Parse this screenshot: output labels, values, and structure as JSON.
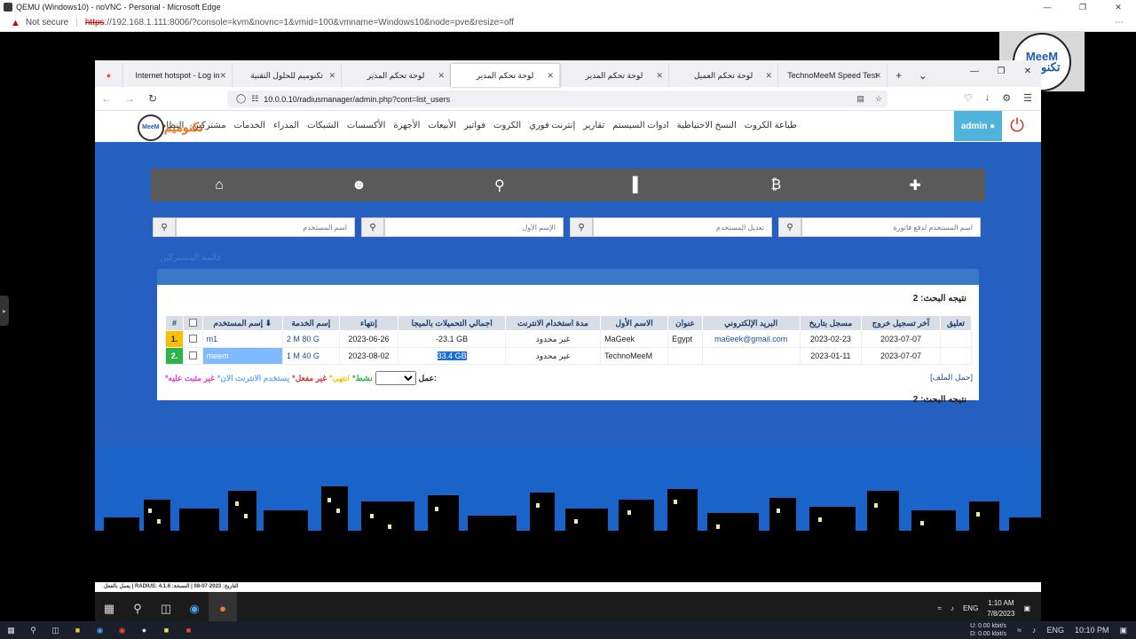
{
  "edge": {
    "title": "QEMU (Windows10) - noVNC - Personal - Microsoft Edge",
    "not_secure": "Not secure",
    "url_proto": "https",
    "url_rest": "://192.168.1.111:8006/?console=kvm&novnc=1&vmid=100&vmname=Windows10&node=pve&resize=off"
  },
  "ff": {
    "tabs": [
      "Internet hotspot - Log in",
      "تكنوميم للحلول التقنية",
      "لوحة تحكم المدير",
      "لوحة تحكم المدير",
      "لوحة تحكم المدير",
      "لوحة تحكم العميل",
      "TechnoMeeM Speed Test"
    ],
    "url": "10.0.0.10/radiusmanager/admin.php?cont=list_users"
  },
  "header": {
    "admin": "admin",
    "menu": [
      "طباعة الكروت",
      "النسخ الاحتياطية",
      "ادوات السيستم",
      "تقارير",
      "إنترنت فوري",
      "الكروت",
      "فواتير",
      "الأبيعات",
      "الأجهزة",
      "الأكسسات",
      "الشبكات",
      "المدراء",
      "الخدمات",
      "مشتركين",
      "النظام"
    ],
    "logo_text": "تكنوميم",
    "logo_badge": "MeeM"
  },
  "search": {
    "ph1": "اسم المستخدم لدفع فاتورة",
    "ph2": "تعديل المستخدم",
    "ph3": "الإسم الأول",
    "ph4": "اسم المستخدم"
  },
  "ghost": "قائمة المشتركين",
  "panel": {
    "result": "نتيجه البحث: 2",
    "headers": [
      "#",
      "",
      "إسم المستخدم ⬇",
      "إسم الخدمة",
      "إنتهاء",
      "اجمالي التحميلات بالميجا",
      "مدة استخدام الانترنت",
      "الاسم الأول",
      "عنوان",
      "البريد الإلكتروني",
      "مسجل بتاريخ",
      "آخر تسجيل خروج",
      "تعليق"
    ],
    "rows": [
      {
        "n": "1.",
        "user": "m1",
        "service": "2 M 80 G",
        "expiry": "2023-06-26",
        "download": "-23.1 GB",
        "duration": "غير محدود",
        "first": "MaGeek",
        "addr": "Egypt",
        "email": "ma6eek@gmail.com",
        "reg": "2023-02-23",
        "logout": "2023-07-07",
        "comment": ""
      },
      {
        "n": "2.",
        "user": "meem",
        "service": "1 M 40 G",
        "expiry": "2023-08-02",
        "download": "33.4 GB",
        "duration": "غير محدود",
        "first": "TechnoMeeM",
        "addr": "",
        "email": "",
        "reg": "2023-01-11",
        "logout": "2023-07-07",
        "comment": ""
      }
    ],
    "action": "عمل:",
    "legend": [
      {
        "t": "*نشط",
        "c": "#2db34a"
      },
      {
        "t": "*انتهى",
        "c": "#f8c000"
      },
      {
        "t": "*غير مفعل",
        "c": "#e03030"
      },
      {
        "t": "*يستخدم الانترنت الان",
        "c": "#6aa9ff"
      },
      {
        "t": "*غير مثبت عليه",
        "c": "#e040c0"
      }
    ],
    "file": "[حمل الملف]"
  },
  "footer": "يعمل بالفعل | RADIUS: التاريخ: 2023-07-08 | النسخة: 4.1.6",
  "vm": {
    "lang": "ENG",
    "time": "1:10 AM",
    "date": "7/8/2023"
  },
  "host": {
    "net1": "0.00 kbit/s",
    "net2": "0.00 kbit/s",
    "u": "U:",
    "d": "D:",
    "lang": "ENG",
    "time": "10:10 PM"
  }
}
